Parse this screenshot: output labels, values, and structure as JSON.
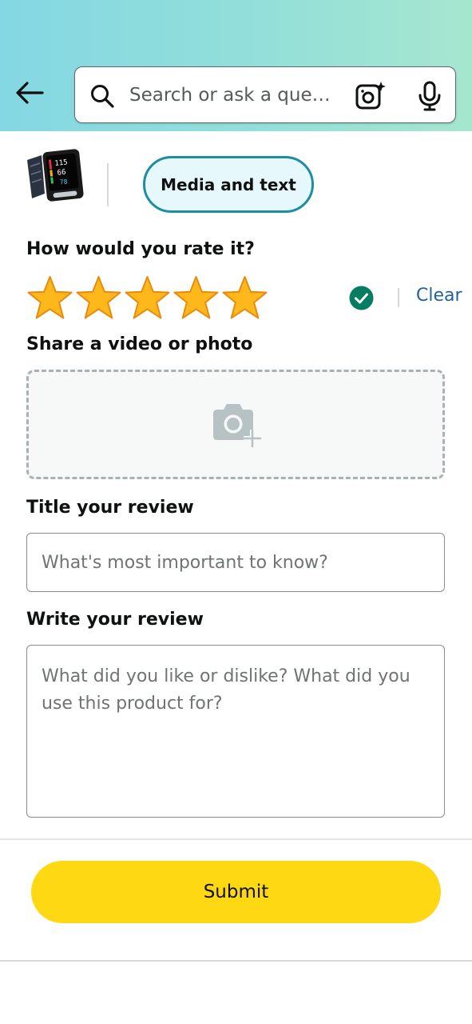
{
  "header": {
    "search_placeholder": "Search or ask a que…",
    "icons": {
      "back": "arrow-left",
      "search": "magnifier",
      "lens": "camera-lens-sparkle",
      "mic": "microphone"
    }
  },
  "tabs": {
    "active_label": "Media and text"
  },
  "rating": {
    "label": "How would you rate it?",
    "stars_selected": 5,
    "stars_total": 5,
    "clear_label": "Clear"
  },
  "media": {
    "label": "Share a video or photo",
    "icon": "camera-plus"
  },
  "title_review": {
    "label": "Title your review",
    "placeholder": "What's most important to know?"
  },
  "write_review": {
    "label": "Write your review",
    "placeholder": "What did you like or dislike? What did you use this product for?"
  },
  "submit_label": "Submit",
  "colors": {
    "accent": "#1b8ea0",
    "submit": "#ffd814",
    "star": "#ffa41c",
    "check": "#067d62",
    "link": "#2162a1"
  }
}
